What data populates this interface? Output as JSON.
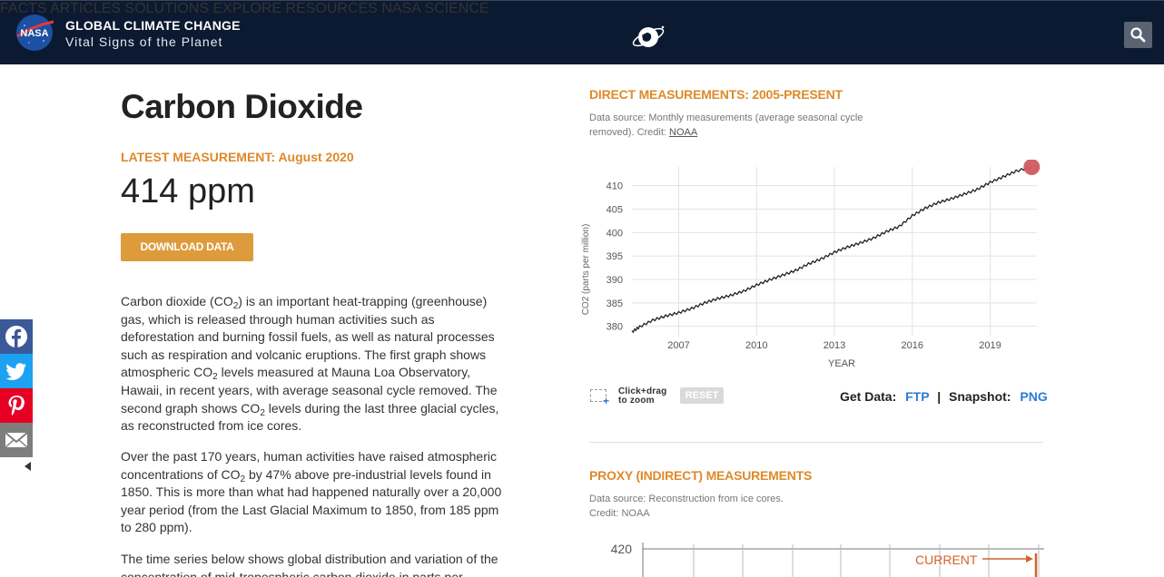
{
  "header": {
    "logo_text": "NASA",
    "title": "GLOBAL CLIMATE CHANGE",
    "subtitle": "Vital Signs of the Planet",
    "nav": [
      "FACTS",
      "ARTICLES",
      "SOLUTIONS",
      "EXPLORE",
      "RESOURCES",
      "NASA SCIENCE"
    ],
    "search_icon": "search-icon",
    "colors": {
      "bar": "#0b1a31",
      "accent": "#dd8a2a",
      "link": "#2a7bd8"
    }
  },
  "left": {
    "title": "Carbon Dioxide",
    "latest_label": "LATEST MEASUREMENT: August 2020",
    "latest_value": "414 ppm",
    "download_label": "DOWNLOAD DATA",
    "paragraphs": {
      "p1": {
        "a": "Carbon dioxide (CO",
        "sub1": "2",
        "b": ") is an important heat-trapping (greenhouse) gas, which is released through human activities such as deforestation and burning fossil fuels, as well as natural processes such as respiration and volcanic eruptions. The first graph shows atmospheric CO",
        "sub2": "2",
        "c": " levels measured at Mauna Loa Observatory, Hawaii, in recent years, with average seasonal cycle removed. The second graph shows CO",
        "sub3": "2",
        "d": " levels during the last three glacial cycles, as reconstructed from ice cores."
      },
      "p2": {
        "a": "Over the past 170 years, human activities have raised atmospheric concentrations of CO",
        "sub1": "2",
        "b": " by 47% above pre-industrial levels found in 1850. This is more than what had happened naturally over a 20,000 year period (from the Last Glacial Maximum to 1850, from 185 ppm to 280 ppm)."
      },
      "p3": "The time series below shows global distribution and variation of the concentration of mid-tropospheric carbon dioxide in parts per"
    }
  },
  "share": [
    "facebook-icon",
    "twitter-icon",
    "pinterest-icon",
    "email-icon"
  ],
  "direct": {
    "title": "DIRECT MEASUREMENTS: 2005-PRESENT",
    "source": "Data source: Monthly measurements (average seasonal cycle removed). Credit:",
    "credit_link": "NOAA",
    "zoom_hint": [
      "Click+drag",
      "to zoom"
    ],
    "reset_label": "RESET",
    "get_data": "Get Data:",
    "ftp": "FTP",
    "separator": "|",
    "snapshot": "Snapshot:",
    "png": "PNG"
  },
  "proxy": {
    "title": "PROXY (INDIRECT) MEASUREMENTS",
    "source_line1": "Data source: Reconstruction from ice cores.",
    "source_line2": "Credit: NOAA",
    "ytick": "420",
    "current_label": "CURRENT"
  },
  "chart_data": {
    "type": "line",
    "xlabel": "YEAR",
    "ylabel": "CO2 (parts per million)",
    "xlim": [
      2005.2,
      2020.8
    ],
    "ylim": [
      378,
      414
    ],
    "xticks": [
      2007,
      2010,
      2013,
      2016,
      2019
    ],
    "yticks": [
      380,
      385,
      390,
      395,
      400,
      405,
      410
    ],
    "grid": true,
    "line_color": "#222222",
    "marker_color": "#d05a5e",
    "x": [
      2005.2,
      2005.5,
      2006.0,
      2006.5,
      2007.0,
      2007.5,
      2008.0,
      2008.5,
      2009.0,
      2009.5,
      2010.0,
      2010.5,
      2011.0,
      2011.5,
      2012.0,
      2012.5,
      2013.0,
      2013.5,
      2014.0,
      2014.5,
      2015.0,
      2015.5,
      2016.0,
      2016.5,
      2017.0,
      2017.5,
      2018.0,
      2018.5,
      2019.0,
      2019.5,
      2020.0,
      2020.6
    ],
    "values": [
      378.8,
      379.9,
      381.3,
      382.2,
      382.9,
      383.8,
      385.0,
      385.9,
      386.6,
      387.5,
      388.8,
      389.9,
      390.9,
      391.9,
      393.3,
      394.4,
      395.8,
      396.9,
      397.8,
      398.8,
      400.2,
      401.3,
      403.6,
      405.2,
      406.4,
      407.2,
      408.2,
      409.2,
      410.7,
      411.9,
      413.1,
      414.0
    ]
  }
}
